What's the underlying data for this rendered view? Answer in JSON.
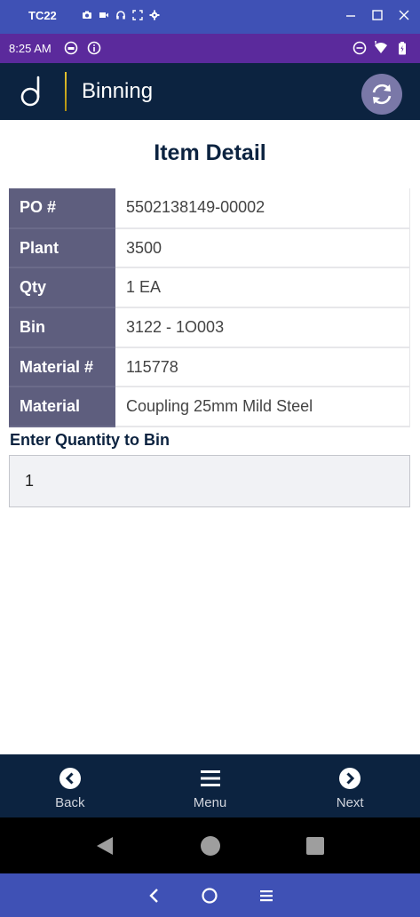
{
  "emulator": {
    "title": "TC22",
    "tool_icons": [
      "camera-icon",
      "video-icon",
      "headphones-icon",
      "fullscreen-icon",
      "settings-icon"
    ],
    "window_controls": [
      "minimize-icon",
      "maximize-icon",
      "close-icon"
    ],
    "bottom_controls": [
      "back-chevron-icon",
      "home-circle-icon",
      "menu-lines-icon"
    ]
  },
  "status_bar": {
    "time": "8:25 AM",
    "left_icons": [
      "app-notification-icon",
      "info-icon"
    ],
    "right_icons": [
      "do-not-disturb-icon",
      "wifi-icon",
      "battery-icon"
    ]
  },
  "header": {
    "title": "Binning",
    "logo_icon": "d-logo-icon",
    "refresh_icon": "refresh-icon"
  },
  "main": {
    "title": "Item Detail",
    "details": [
      {
        "label": "PO #",
        "value": "5502138149-00002"
      },
      {
        "label": "Plant",
        "value": "3500"
      },
      {
        "label": "Qty",
        "value": "1 EA"
      },
      {
        "label": "Bin",
        "value": "3122 - 1O003"
      },
      {
        "label": "Material #",
        "value": "115778"
      },
      {
        "label": "Material",
        "value": "Coupling 25mm Mild Steel"
      }
    ],
    "quantity_label": "Enter Quantity to Bin",
    "quantity_value": "1"
  },
  "bottom_nav": {
    "back_label": "Back",
    "menu_label": "Menu",
    "next_label": "Next"
  },
  "system_nav": [
    "android-back-icon",
    "android-home-icon",
    "android-recents-icon"
  ],
  "colors": {
    "header_bg": "#0c2340",
    "status_bar_bg": "#5b2a9c",
    "emulator_bar_bg": "#3f51b5",
    "label_cell_bg": "#5e5e7e",
    "accent_gold": "#d4af37"
  }
}
